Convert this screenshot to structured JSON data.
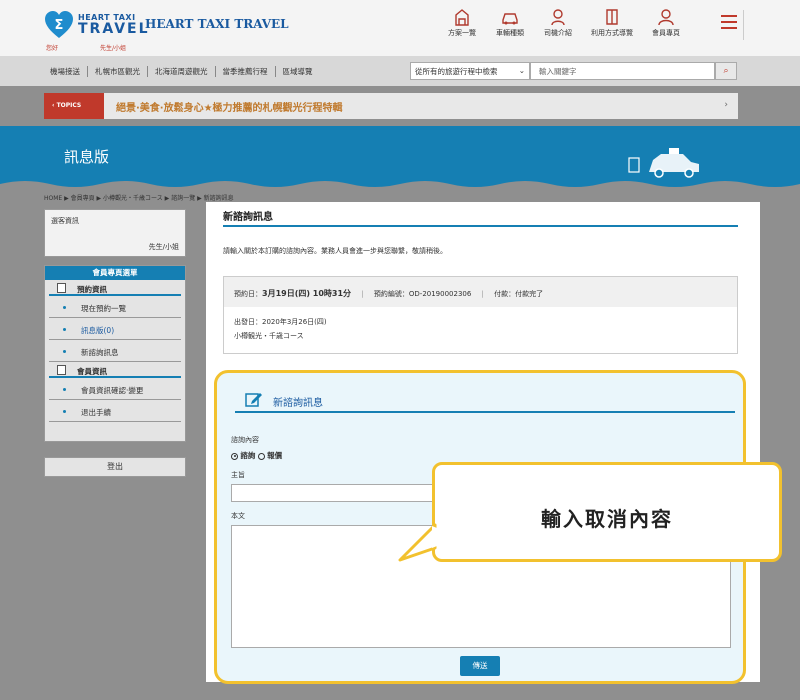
{
  "header": {
    "logo_line1": "HEART TAXI",
    "logo_line2": "TRAVEL",
    "brand": "HEART TAXI TRAVEL",
    "greeting": "您好",
    "user_name": "先生/小姐",
    "nav": [
      "方案一覽",
      "車輛種類",
      "司機介紹",
      "利用方式導覽",
      "會員專頁"
    ]
  },
  "subnav": {
    "links": [
      "機場接送",
      "札幌市區觀光",
      "北海道周遊觀光",
      "當季推薦行程",
      "區域導覽"
    ],
    "search_select": "從所有的旅遊行程中檢索",
    "search_placeholder": "輸入關鍵字"
  },
  "topics": {
    "tag": "TOPICS",
    "text": "絕景·美食·放鬆身心★極力推薦的札幌觀光行程特輯",
    "arrow": "›"
  },
  "banner": {
    "title": "訊息版"
  },
  "breadcrumb": "HOME ▶ 會員專頁 ▶ 小樽觀光・千歳コース ▶ 諮詢一覽 ▶ 新諮詢訊息",
  "sidebar": {
    "box_title": "選客資訊",
    "box_user": "先生/小姐",
    "menu_header": "會員專頁選單",
    "group1": "預約資訊",
    "items1": [
      "現在預約一覽",
      "訊息版(0)",
      "新諮詢訊息"
    ],
    "group2": "會員資訊",
    "items2": [
      "會員資訊確認·變更",
      "退出手續"
    ],
    "logout": "登出"
  },
  "main": {
    "title": "新諮詢訊息",
    "desc": "請輸入關於本訂購的諮詢內容。業務人員會進一步與您聯繫，敬請稍後。",
    "reserve_date_label": "預約日：",
    "reserve_date": "3月19日(四) 10時31分",
    "reserve_no_label": "預約編號：",
    "reserve_no": "OD-20190002306",
    "payment_label": "付款：",
    "payment": "付款完了",
    "depart_label": "出發日：",
    "depart": "2020年3月26日(四)",
    "course": "小樽観光・千歳コース"
  },
  "form": {
    "title": "新諮詢訊息",
    "type_label": "諮詢內容",
    "opt1": "諮詢",
    "opt2": "報價",
    "subject_label": "主旨",
    "body_label": "本文",
    "send": "傳送"
  },
  "callout": {
    "text": "輸入取消內容"
  },
  "colors": {
    "primary": "#157fb3",
    "accent": "#c0392b",
    "highlight": "#f2c12e"
  }
}
